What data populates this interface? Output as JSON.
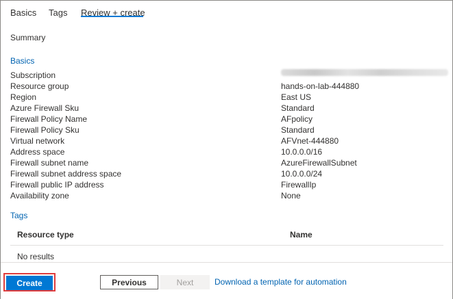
{
  "tabs": [
    {
      "label": "Basics"
    },
    {
      "label": "Tags"
    },
    {
      "label": "Review + create"
    }
  ],
  "summary_label": "Summary",
  "basics_title": "Basics",
  "basics_rows": [
    {
      "label": "Subscription",
      "value": ""
    },
    {
      "label": "Resource group",
      "value": "hands-on-lab-444880"
    },
    {
      "label": "Region",
      "value": "East US"
    },
    {
      "label": "Azure Firewall Sku",
      "value": "Standard"
    },
    {
      "label": "Firewall Policy Name",
      "value": "AFpolicy"
    },
    {
      "label": "Firewall Policy Sku",
      "value": "Standard"
    },
    {
      "label": "Virtual network",
      "value": "AFVnet-444880"
    },
    {
      "label": "Address space",
      "value": "10.0.0.0/16"
    },
    {
      "label": "Firewall subnet name",
      "value": "AzureFirewallSubnet"
    },
    {
      "label": "Firewall subnet address space",
      "value": "10.0.0.0/24"
    },
    {
      "label": "Firewall public IP address",
      "value": "FirewallIp"
    },
    {
      "label": "Availability zone",
      "value": "None"
    }
  ],
  "tags_title": "Tags",
  "tags_table": {
    "col_resource_type": "Resource type",
    "col_name": "Name",
    "empty_text": "No results"
  },
  "footer": {
    "create_label": "Create",
    "previous_label": "Previous",
    "next_label": "Next",
    "download_link": "Download a template for automation"
  },
  "colors": {
    "accent": "#0078d4",
    "link": "#0063b1",
    "highlight_outline": "#e03c3c"
  }
}
